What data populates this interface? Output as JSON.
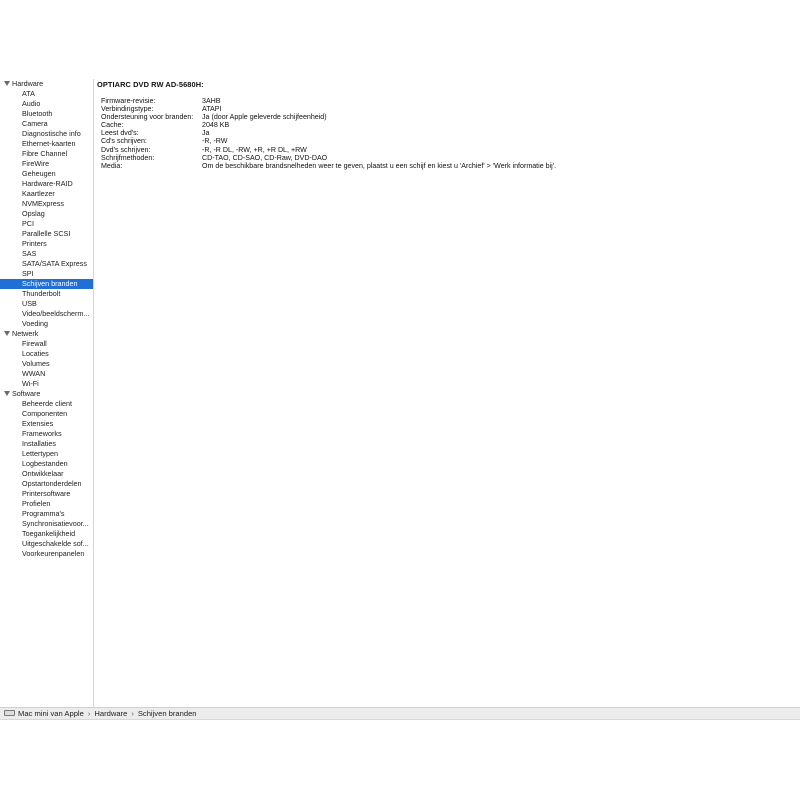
{
  "sidebar": {
    "groups": [
      {
        "label": "Hardware",
        "items": [
          "ATA",
          "Audio",
          "Bluetooth",
          "Camera",
          "Diagnostische info",
          "Ethernet-kaarten",
          "Fibre Channel",
          "FireWire",
          "Geheugen",
          "Hardware-RAID",
          "Kaartlezer",
          "NVMExpress",
          "Opslag",
          "PCI",
          "Parallelle SCSI",
          "Printers",
          "SAS",
          "SATA/SATA Express",
          "SPI",
          "Schijven branden",
          "Thunderbolt",
          "USB",
          "Video/beeldscherm...",
          "Voeding"
        ]
      },
      {
        "label": "Netwerk",
        "items": [
          "Firewall",
          "Locaties",
          "Volumes",
          "WWAN",
          "Wi-Fi"
        ]
      },
      {
        "label": "Software",
        "items": [
          "Beheerde client",
          "Componenten",
          "Extensies",
          "Frameworks",
          "Installaties",
          "Lettertypen",
          "Logbestanden",
          "Ontwikkelaar",
          "Opstartonderdelen",
          "Printersoftware",
          "Profielen",
          "Programma's",
          "Synchronisatievoor...",
          "Toegankelijkheid",
          "Uitgeschakelde sof...",
          "Voorkeurenpanelen"
        ]
      }
    ],
    "selected": "Schijven branden"
  },
  "content": {
    "device_title": "OPTIARC DVD RW AD-5680H:",
    "properties": [
      {
        "key": "Firmware-revisie:",
        "value": "3AHB"
      },
      {
        "key": "Verbindingstype:",
        "value": "ATAPI"
      },
      {
        "key": "Ondersteuning voor branden:",
        "value": "Ja (door Apple geleverde schijfeenheid)"
      },
      {
        "key": "Cache:",
        "value": "2048 KB"
      },
      {
        "key": "Leest dvd's:",
        "value": "Ja"
      },
      {
        "key": "Cd's schrijven:",
        "value": "-R, -RW"
      },
      {
        "key": "Dvd's schrijven:",
        "value": "-R, -R DL, -RW, +R, +R DL, +RW"
      },
      {
        "key": "Schrijfmethoden:",
        "value": "CD-TAO, CD-SAO, CD-Raw, DVD-DAO"
      },
      {
        "key": "Media:",
        "value": "Om de beschikbare brandsnelheden weer te geven, plaatst u een schijf en kiest u 'Archief' > 'Werk informatie bij'."
      }
    ]
  },
  "statusbar": {
    "icon": "mac-mini-icon",
    "path": [
      "Mac mini van Apple",
      "Hardware",
      "Schijven branden"
    ],
    "separator": "›"
  }
}
